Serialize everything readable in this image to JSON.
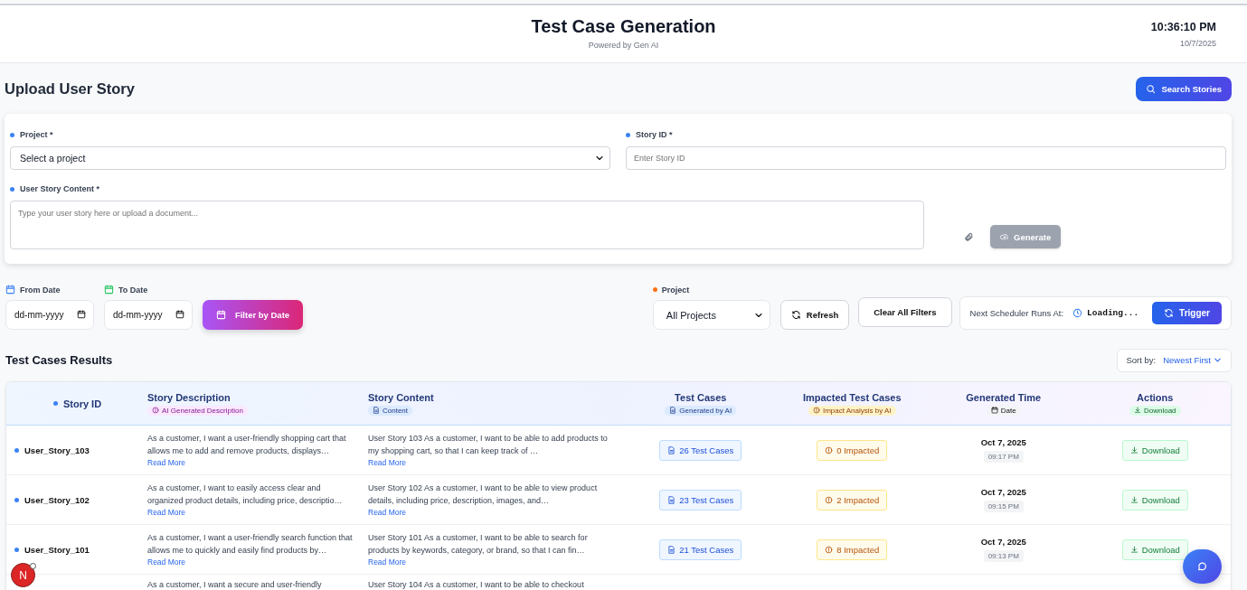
{
  "header": {
    "title": "Test Case Generation",
    "subtitle": "Powered by Gen AI",
    "time": "10:36:10 PM",
    "date": "10/7/2025"
  },
  "upload": {
    "title": "Upload User Story",
    "search_button": "Search Stories",
    "project": {
      "label": "Project *",
      "value": "Select a project"
    },
    "story_id": {
      "label": "Story ID *",
      "placeholder": "Enter Story ID"
    },
    "content": {
      "label": "User Story Content *",
      "placeholder": "Type your user story here or upload a document..."
    },
    "generate_button": {
      "label": "Generate",
      "disabled": true
    }
  },
  "filters": {
    "from_date": {
      "label": "From Date",
      "placeholder": "dd-mm-yyyy"
    },
    "to_date": {
      "label": "To Date",
      "placeholder": "dd-mm-yyyy"
    },
    "filter_button": "Filter by Date",
    "project": {
      "label": "Project",
      "value": "All Projects"
    },
    "refresh_button": "Refresh",
    "clear_button": "Clear All Filters",
    "scheduler": {
      "label": "Next Scheduler Runs At:",
      "status": "Loading...",
      "trigger_button": "Trigger"
    }
  },
  "results": {
    "title": "Test Cases Results",
    "sort": {
      "label": "Sort by:",
      "value": "Newest First"
    },
    "columns": [
      {
        "title": "Story ID"
      },
      {
        "title": "Story Description",
        "badge": "AI Generated Description"
      },
      {
        "title": "Story Content",
        "badge": "Content"
      },
      {
        "title": "Test Cases",
        "badge": "Generated by AI"
      },
      {
        "title": "Impacted Test Cases",
        "badge": "Impact Analysis by AI"
      },
      {
        "title": "Generated Time",
        "badge": "Date"
      },
      {
        "title": "Actions",
        "badge": "Download"
      }
    ],
    "rows": [
      {
        "story_id": "User_Story_103",
        "description": "As a customer, I want a user-friendly shopping cart that allows me to add and remove products, displays…",
        "description_link": "Read More",
        "content": "User Story 103 As a customer, I want to be able to add products to my shopping cart, so that I can keep track of …",
        "content_link": "Read More",
        "test_cases": "26 Test Cases",
        "impacted": "0 Impacted",
        "date": "Oct 7, 2025",
        "time": "09:17 PM",
        "action": "Download"
      },
      {
        "story_id": "User_Story_102",
        "description": "As a customer, I want to easily access clear and organized product details, including price, descriptio…",
        "description_link": "Read More",
        "content": "User Story 102 As a customer, I want to be able to view product details, including price, description, images, and…",
        "content_link": "Read More",
        "test_cases": "23 Test Cases",
        "impacted": "2 Impacted",
        "date": "Oct 7, 2025",
        "time": "09:15 PM",
        "action": "Download"
      },
      {
        "story_id": "User_Story_101",
        "description": "As a customer, I want a user-friendly search function that allows me to quickly and easily find products by…",
        "description_link": "Read More",
        "content": "User Story 101 As a customer, I want to be able to search for products by keywords, category, or brand, so that I can fin…",
        "content_link": "Read More",
        "test_cases": "21 Test Cases",
        "impacted": "8 Impacted",
        "date": "Oct 7, 2025",
        "time": "09:13 PM",
        "action": "Download"
      },
      {
        "description": "As a customer, I want a secure and user-friendly",
        "content": "User Story 104 As a customer, I want to be able to checkout"
      }
    ]
  },
  "avatar": {
    "initial": "N"
  }
}
